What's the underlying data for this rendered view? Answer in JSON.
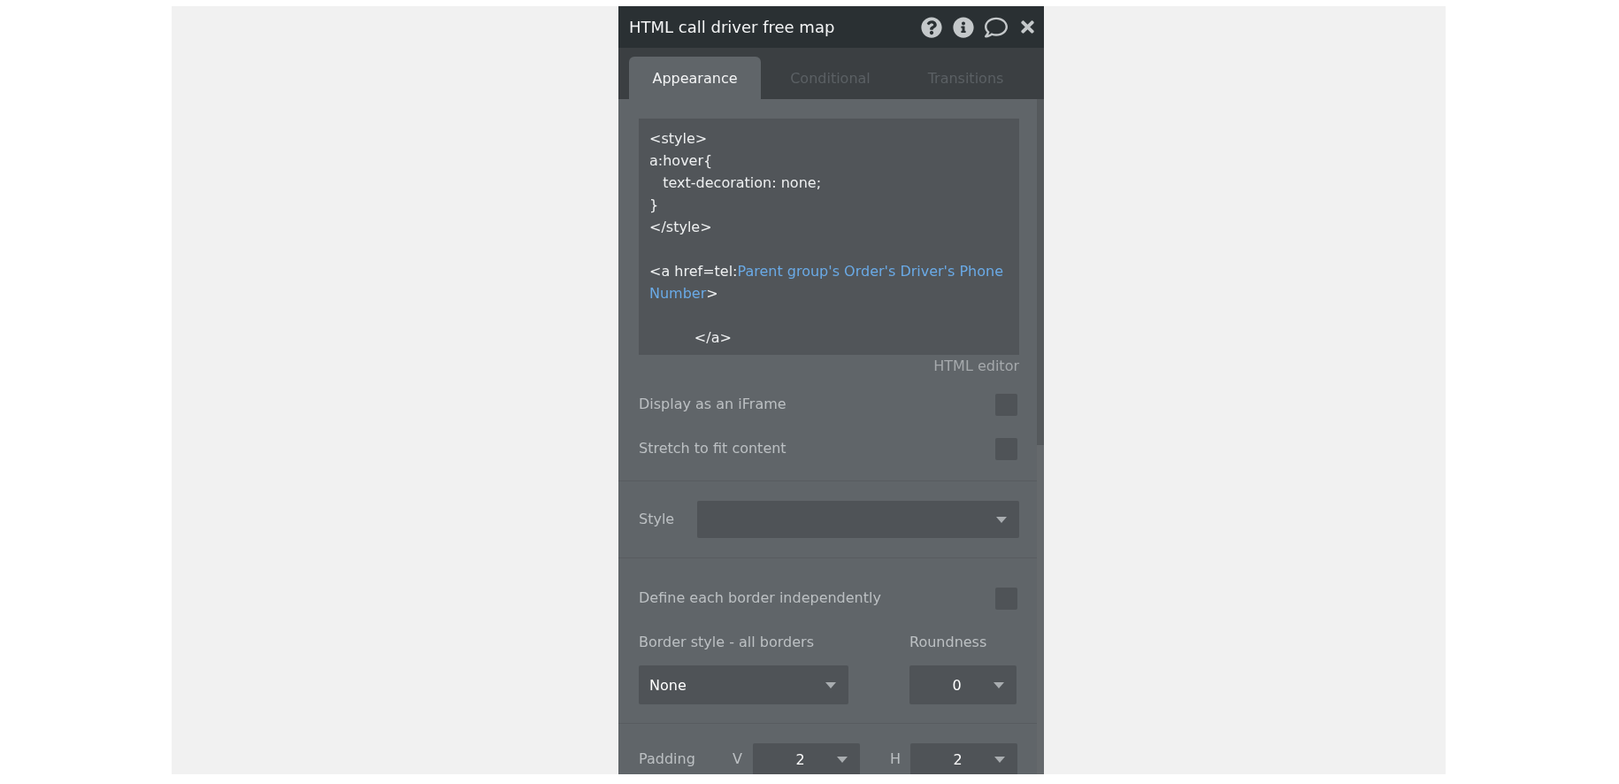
{
  "panel": {
    "title": "HTML call driver free map"
  },
  "tabs": [
    {
      "label": "Appearance",
      "selected": true
    },
    {
      "label": "Conditional",
      "selected": false
    },
    {
      "label": "Transitions",
      "selected": false
    }
  ],
  "html_editor": {
    "blocks": [
      [
        [
          {
            "kind": "plain",
            "text": "<style>"
          }
        ],
        [
          {
            "kind": "plain",
            "text": "a:hover{"
          }
        ],
        [
          {
            "kind": "plain",
            "text": "   text-decoration: none;"
          }
        ],
        [
          {
            "kind": "plain",
            "text": "}"
          }
        ],
        [
          {
            "kind": "plain",
            "text": "</style>"
          }
        ]
      ],
      [
        [
          {
            "kind": "plain",
            "text": "<a href=tel:"
          },
          {
            "kind": "dynamic",
            "text": "Parent group's Order's Driver's Phone Number"
          },
          {
            "kind": "plain",
            "text": ">"
          }
        ]
      ],
      [
        [
          {
            "kind": "plain",
            "text": "          </a>"
          }
        ]
      ]
    ],
    "caption": "HTML editor"
  },
  "options": [
    {
      "label": "Display as an iFrame",
      "checked": false
    },
    {
      "label": "Stretch to fit content",
      "checked": false
    }
  ],
  "style": {
    "label": "Style"
  },
  "border": {
    "independent": {
      "label": "Define each border independently",
      "checked": false
    },
    "style": {
      "label": "Border style - all borders",
      "value": "None"
    },
    "roundness": {
      "label": "Roundness",
      "value": "0"
    }
  },
  "padding": {
    "label": "Padding",
    "fields": [
      {
        "axis": "V",
        "value": "2"
      },
      {
        "axis": "H",
        "value": "2"
      }
    ]
  }
}
